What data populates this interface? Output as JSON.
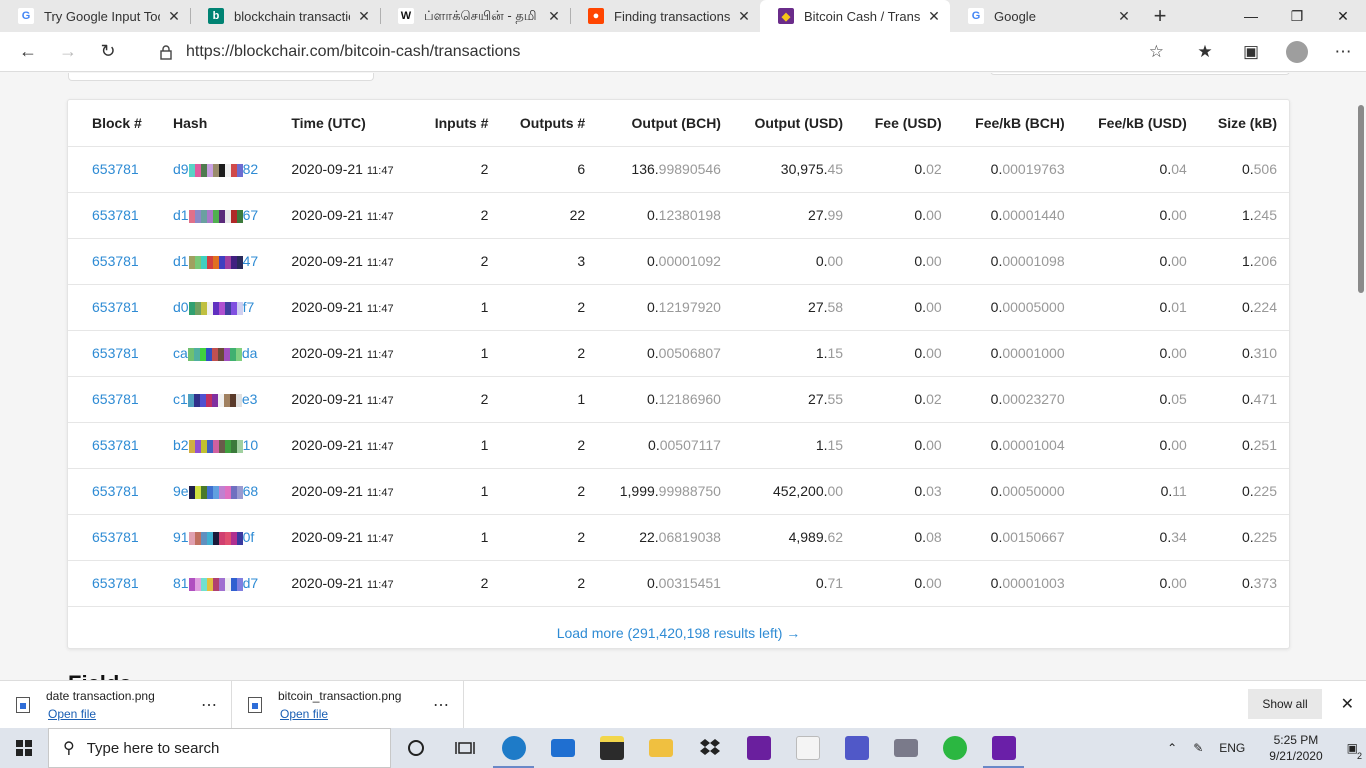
{
  "tabs": [
    {
      "title": "Try Google Input Tools",
      "icon": "google-icon",
      "active": false
    },
    {
      "title": "blockchain transaction",
      "icon": "bing-icon",
      "active": false
    },
    {
      "title": "ப்ளாக்செயின் - தமி",
      "icon": "wikipedia-icon",
      "active": false
    },
    {
      "title": "Finding transactions on",
      "icon": "reddit-icon",
      "active": false
    },
    {
      "title": "Bitcoin Cash / Transactio",
      "icon": "blockchair-icon",
      "active": true
    },
    {
      "title": "Google",
      "icon": "google-icon",
      "active": false
    }
  ],
  "address": {
    "url": "https://blockchair.com/bitcoin-cash/transactions"
  },
  "table": {
    "headers": [
      "Block #",
      "Hash",
      "Time (UTC)",
      "Inputs #",
      "Outputs #",
      "Output (BCH)",
      "Output (USD)",
      "Fee (USD)",
      "Fee/kB (BCH)",
      "Fee/kB (USD)",
      "Size (kB)"
    ],
    "rows": [
      {
        "block": "653781",
        "hash_start": "d9",
        "hash_end": "82",
        "date": "2020-09-21",
        "time": "11:47",
        "inputs": "2",
        "outputs": "6",
        "out_bch_a": "136.",
        "out_bch_b": "99890546",
        "out_usd_a": "30,975.",
        "out_usd_b": "45",
        "fee_a": "0.",
        "fee_b": "02",
        "fkb_bch_a": "0.",
        "fkb_bch_b": "00019763",
        "fkb_usd_a": "0.",
        "fkb_usd_b": "04",
        "size_a": "0.",
        "size_b": "506",
        "colors": [
          "#5ad3c6",
          "#e05c9e",
          "#4f7a4f",
          "#c8a0e0",
          "#9a8c6c",
          "#1c1c1c",
          "#f0f0f0",
          "#d04a4a",
          "#6c6cd0"
        ]
      },
      {
        "block": "653781",
        "hash_start": "d1",
        "hash_end": "67",
        "date": "2020-09-21",
        "time": "11:47",
        "inputs": "2",
        "outputs": "22",
        "out_bch_a": "0.",
        "out_bch_b": "12380198",
        "out_usd_a": "27.",
        "out_usd_b": "99",
        "fee_a": "0.",
        "fee_b": "00",
        "fkb_bch_a": "0.",
        "fkb_bch_b": "00001440",
        "fkb_usd_a": "0.",
        "fkb_usd_b": "00",
        "size_a": "1.",
        "size_b": "245",
        "colors": [
          "#e0708a",
          "#8a8ac8",
          "#6aa0a0",
          "#a878c8",
          "#50b050",
          "#5a2a7a",
          "#e8e8e8",
          "#b02828",
          "#3c7a3c"
        ]
      },
      {
        "block": "653781",
        "hash_start": "d1",
        "hash_end": "47",
        "date": "2020-09-21",
        "time": "11:47",
        "inputs": "2",
        "outputs": "3",
        "out_bch_a": "0.",
        "out_bch_b": "00001092",
        "out_usd_a": "0.",
        "out_usd_b": "00",
        "fee_a": "0.",
        "fee_b": "00",
        "fkb_bch_a": "0.",
        "fkb_bch_b": "00001098",
        "fkb_usd_a": "0.",
        "fkb_usd_b": "00",
        "size_a": "1.",
        "size_b": "206",
        "colors": [
          "#a0a060",
          "#78c878",
          "#40d0c0",
          "#d04040",
          "#e07020",
          "#4040c0",
          "#a040a0",
          "#402080",
          "#2a2a5a"
        ]
      },
      {
        "block": "653781",
        "hash_start": "d0",
        "hash_end": "f7",
        "date": "2020-09-21",
        "time": "11:47",
        "inputs": "1",
        "outputs": "2",
        "out_bch_a": "0.",
        "out_bch_b": "12197920",
        "out_usd_a": "27.",
        "out_usd_b": "58",
        "fee_a": "0.",
        "fee_b": "00",
        "fkb_bch_a": "0.",
        "fkb_bch_b": "00005000",
        "fkb_usd_a": "0.",
        "fkb_usd_b": "01",
        "size_a": "0.",
        "size_b": "224",
        "colors": [
          "#30a070",
          "#70a060",
          "#c0c040",
          "#f0f0f0",
          "#6030c0",
          "#b050d0",
          "#4040a0",
          "#8050e0",
          "#d0d0f0"
        ]
      },
      {
        "block": "653781",
        "hash_start": "ca",
        "hash_end": "da",
        "date": "2020-09-21",
        "time": "11:47",
        "inputs": "1",
        "outputs": "2",
        "out_bch_a": "0.",
        "out_bch_b": "00506807",
        "out_usd_a": "1.",
        "out_usd_b": "15",
        "fee_a": "0.",
        "fee_b": "00",
        "fkb_bch_a": "0.",
        "fkb_bch_b": "00001000",
        "fkb_usd_a": "0.",
        "fkb_usd_b": "00",
        "size_a": "0.",
        "size_b": "310",
        "colors": [
          "#70c070",
          "#50b0a0",
          "#40d040",
          "#3050c0",
          "#c05050",
          "#6a4a3a",
          "#a050c0",
          "#40b070",
          "#80d080"
        ]
      },
      {
        "block": "653781",
        "hash_start": "c1",
        "hash_end": "e3",
        "date": "2020-09-21",
        "time": "11:47",
        "inputs": "2",
        "outputs": "1",
        "out_bch_a": "0.",
        "out_bch_b": "12186960",
        "out_usd_a": "27.",
        "out_usd_b": "55",
        "fee_a": "0.",
        "fee_b": "02",
        "fkb_bch_a": "0.",
        "fkb_bch_b": "00023270",
        "fkb_usd_a": "0.",
        "fkb_usd_b": "05",
        "size_a": "0.",
        "size_b": "471",
        "colors": [
          "#50a0c0",
          "#30308a",
          "#5050d0",
          "#c03060",
          "#8030a0",
          "#f0f0f0",
          "#a08060",
          "#5a3a2a",
          "#e0e0e0"
        ]
      },
      {
        "block": "653781",
        "hash_start": "b2",
        "hash_end": "10",
        "date": "2020-09-21",
        "time": "11:47",
        "inputs": "1",
        "outputs": "2",
        "out_bch_a": "0.",
        "out_bch_b": "00507117",
        "out_usd_a": "1.",
        "out_usd_b": "15",
        "fee_a": "0.",
        "fee_b": "00",
        "fkb_bch_a": "0.",
        "fkb_bch_b": "00001004",
        "fkb_usd_a": "0.",
        "fkb_usd_b": "00",
        "size_a": "0.",
        "size_b": "251",
        "colors": [
          "#d0b040",
          "#9050d0",
          "#c0c030",
          "#4060c0",
          "#d060a0",
          "#6a5a4a",
          "#40a040",
          "#3a7a3a",
          "#a0d0a0"
        ]
      },
      {
        "block": "653781",
        "hash_start": "9e",
        "hash_end": "68",
        "date": "2020-09-21",
        "time": "11:47",
        "inputs": "1",
        "outputs": "2",
        "out_bch_a": "1,999.",
        "out_bch_b": "99988750",
        "out_usd_a": "452,200.",
        "out_usd_b": "00",
        "fee_a": "0.",
        "fee_b": "03",
        "fkb_bch_a": "0.",
        "fkb_bch_b": "00050000",
        "fkb_usd_a": "0.",
        "fkb_usd_b": "11",
        "size_a": "0.",
        "size_b": "225",
        "colors": [
          "#20204a",
          "#d0e040",
          "#4a7a2a",
          "#4070d0",
          "#60a0e0",
          "#c080d0",
          "#e070c0",
          "#7070c0",
          "#9a9ad0"
        ]
      },
      {
        "block": "653781",
        "hash_start": "91",
        "hash_end": "0f",
        "date": "2020-09-21",
        "time": "11:47",
        "inputs": "1",
        "outputs": "2",
        "out_bch_a": "22.",
        "out_bch_b": "06819038",
        "out_usd_a": "4,989.",
        "out_usd_b": "62",
        "fee_a": "0.",
        "fee_b": "08",
        "fkb_bch_a": "0.",
        "fkb_bch_b": "00150667",
        "fkb_usd_a": "0.",
        "fkb_usd_b": "34",
        "size_a": "0.",
        "size_b": "225",
        "colors": [
          "#e0a0b0",
          "#c07060",
          "#6090c0",
          "#40b0d0",
          "#1a1a3a",
          "#d04070",
          "#e05070",
          "#b03090",
          "#3a3aa0"
        ]
      },
      {
        "block": "653781",
        "hash_start": "81",
        "hash_end": "d7",
        "date": "2020-09-21",
        "time": "11:47",
        "inputs": "2",
        "outputs": "2",
        "out_bch_a": "0.",
        "out_bch_b": "00315451",
        "out_usd_a": "0.",
        "out_usd_b": "71",
        "fee_a": "0.",
        "fee_b": "00",
        "fkb_bch_a": "0.",
        "fkb_bch_b": "00001003",
        "fkb_usd_a": "0.",
        "fkb_usd_b": "00",
        "size_a": "0.",
        "size_b": "373",
        "colors": [
          "#b050c0",
          "#e0a0e0",
          "#70e0d0",
          "#e0c040",
          "#b04070",
          "#a070d0",
          "#f0f0f0",
          "#3060d0",
          "#8080e0"
        ]
      }
    ]
  },
  "load_more": "Load more (291,420,198 results left) →",
  "fields_heading": "Fields",
  "downloads": [
    {
      "name": "date transaction.png",
      "action": "Open file"
    },
    {
      "name": "bitcoin_transaction.png",
      "action": "Open file"
    }
  ],
  "show_all": "Show all",
  "taskbar": {
    "search_placeholder": "Type here to search",
    "lang": "ENG",
    "time": "5:25 PM",
    "date": "9/21/2020",
    "notifications": "2"
  },
  "colors": {
    "link": "#2e8bd4",
    "dim": "#999999"
  }
}
